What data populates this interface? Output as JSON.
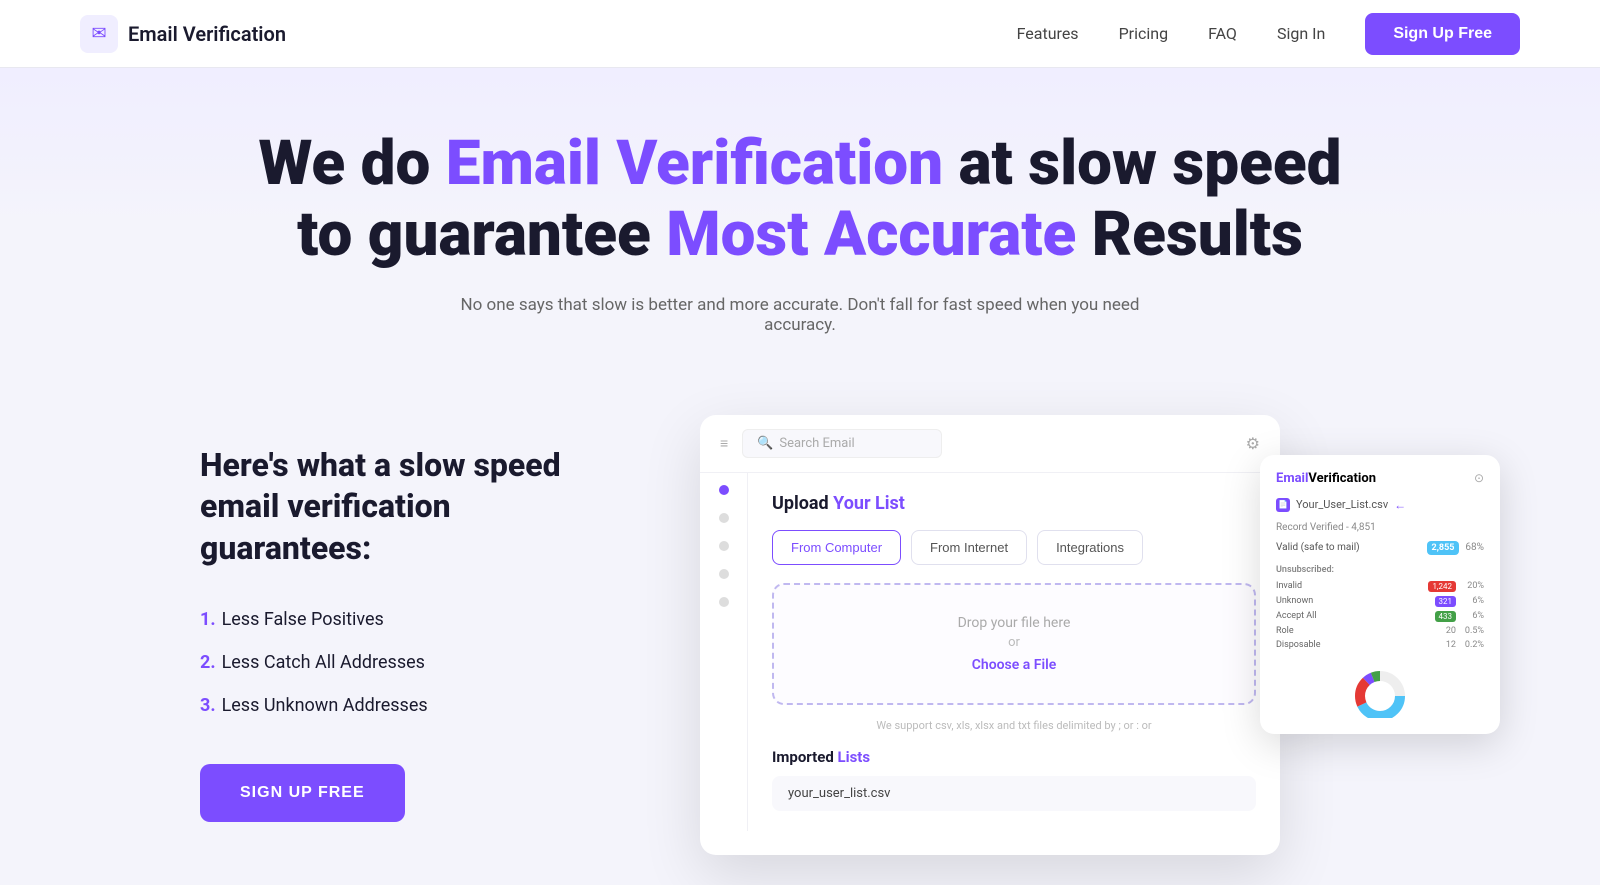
{
  "nav": {
    "logo_icon": "✉",
    "logo_text": "Email Verification",
    "links": [
      {
        "label": "Features",
        "name": "features"
      },
      {
        "label": "Pricing",
        "name": "pricing"
      },
      {
        "label": "FAQ",
        "name": "faq"
      },
      {
        "label": "Sign In",
        "name": "signin"
      }
    ],
    "cta_label": "Sign Up Free"
  },
  "hero": {
    "headline_prefix": "We do ",
    "headline_accent": "Email Verification",
    "headline_suffix": " at slow speed",
    "headline2_prefix": "to guarantee ",
    "headline2_accent": "Most Accurate",
    "headline2_suffix": " Results",
    "subtext": "No one says that slow is better and more accurate. Don't fall for fast speed when you need accuracy."
  },
  "left": {
    "heading_line1": "Here's what a slow speed",
    "heading_line2": "email verification guarantees:",
    "items": [
      {
        "num": "1.",
        "text": "Less False Positives"
      },
      {
        "num": "2.",
        "text": "Less Catch All Addresses"
      },
      {
        "num": "3.",
        "text": "Less Unknown Addresses"
      }
    ],
    "cta_label": "SIGN UP FREE"
  },
  "mockup": {
    "search_placeholder": "Search Email",
    "upload_title": "Upload ",
    "upload_title_accent": "Your List",
    "tabs": [
      "From Computer",
      "From Internet",
      "Integrations"
    ],
    "dropzone_text": "Drop your file here",
    "or_text": "or",
    "choose_link": "Choose a File",
    "support_text": "We support csv, xls, xlsx and txt files delimited by ; or : or",
    "imported_title": "Imported ",
    "imported_accent": "Lists",
    "list_file": "your_user_list.csv"
  },
  "overlay": {
    "title_brand": "Email",
    "title_rest": "Verification",
    "file_name": "Your_User_List.csv",
    "record_text": "Record Verified - 4,851",
    "valid_label": "Valid (safe to mail)",
    "valid_count": "2,855",
    "valid_pct": "68%",
    "unsub_label": "Unsubscribed:",
    "stats": [
      {
        "name": "Invalid",
        "badge_type": "red",
        "count": "1,242",
        "pct": "20%"
      },
      {
        "name": "Unknown",
        "badge_type": "purple",
        "count": "321",
        "pct": "6%"
      },
      {
        "name": "Accept All",
        "badge_type": "green",
        "count": "433",
        "pct": "6%"
      },
      {
        "name": "Role",
        "badge_type": "none",
        "count": "20",
        "pct": "0.5%"
      },
      {
        "name": "Disposable",
        "badge_type": "none",
        "count": "12",
        "pct": "0.2%"
      }
    ]
  }
}
